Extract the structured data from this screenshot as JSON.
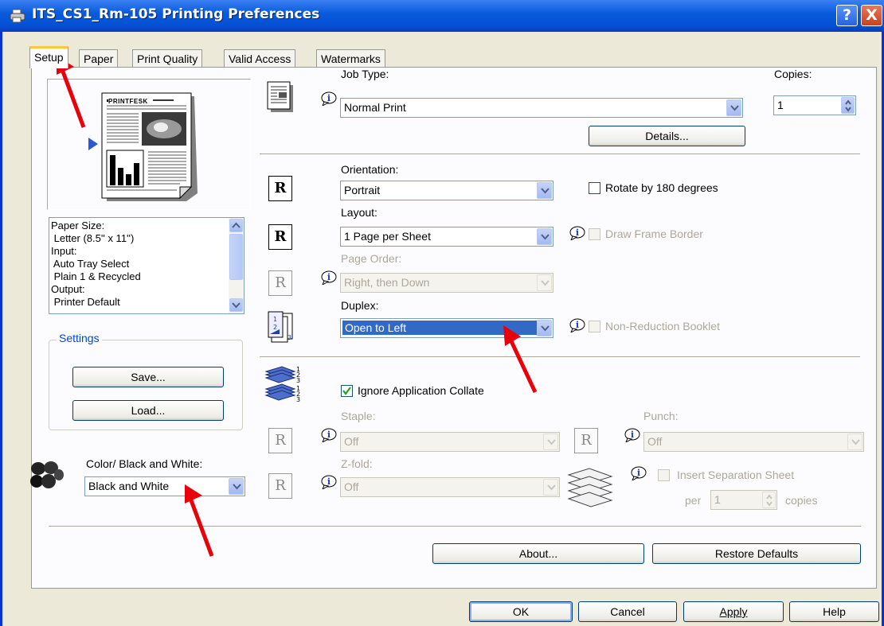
{
  "window": {
    "title": "ITS_CS1_Rm-105 Printing Preferences"
  },
  "titlebar_buttons": {
    "help": "?",
    "close": "X"
  },
  "tabs": [
    "Setup",
    "Paper",
    "Print Quality",
    "Valid Access",
    "Watermarks"
  ],
  "active_tab": "Setup",
  "preview": {
    "headline": "PRINTFESK"
  },
  "summary": {
    "lines": [
      "Paper Size:",
      " Letter (8.5'' x 11'')",
      "Input:",
      " Auto Tray Select",
      " Plain 1 & Recycled",
      "Output:",
      " Printer Default"
    ]
  },
  "settings_group": {
    "label": "Settings",
    "save": "Save...",
    "load": "Load..."
  },
  "color": {
    "label": "Color/ Black and White:",
    "value": "Black and White"
  },
  "job": {
    "label": "Job Type:",
    "value": "Normal Print",
    "details": "Details..."
  },
  "copies": {
    "label": "Copies:",
    "value": "1"
  },
  "orientation": {
    "label": "Orientation:",
    "value": "Portrait",
    "rotate": "Rotate by 180 degrees",
    "rotate_checked": false
  },
  "layout": {
    "label": "Layout:",
    "value": "1 Page per Sheet",
    "frame": "Draw Frame Border",
    "frame_checked": false
  },
  "page_order": {
    "label": "Page Order:",
    "value": "Right, then Down"
  },
  "duplex": {
    "label": "Duplex:",
    "value": "Open to Left",
    "booklet": "Non-Reduction Booklet"
  },
  "collate": {
    "label": "Ignore Application Collate",
    "checked": true
  },
  "staple": {
    "label": "Staple:",
    "value": "Off"
  },
  "punch": {
    "label": "Punch:",
    "value": "Off"
  },
  "zfold": {
    "label": "Z-fold:",
    "value": "Off"
  },
  "separation": {
    "label": "Insert Separation Sheet",
    "per": "per",
    "per_value": "1",
    "copies": "copies"
  },
  "panel_buttons": {
    "about": "About...",
    "restore": "Restore Defaults"
  },
  "dialog_buttons": {
    "ok": "OK",
    "cancel": "Cancel",
    "apply": "Apply",
    "help": "Help"
  },
  "colors": {
    "titlebar": "#0450d6",
    "selection": "#316ac5",
    "annotation": "#e8000a",
    "face": "#ece9d8"
  }
}
